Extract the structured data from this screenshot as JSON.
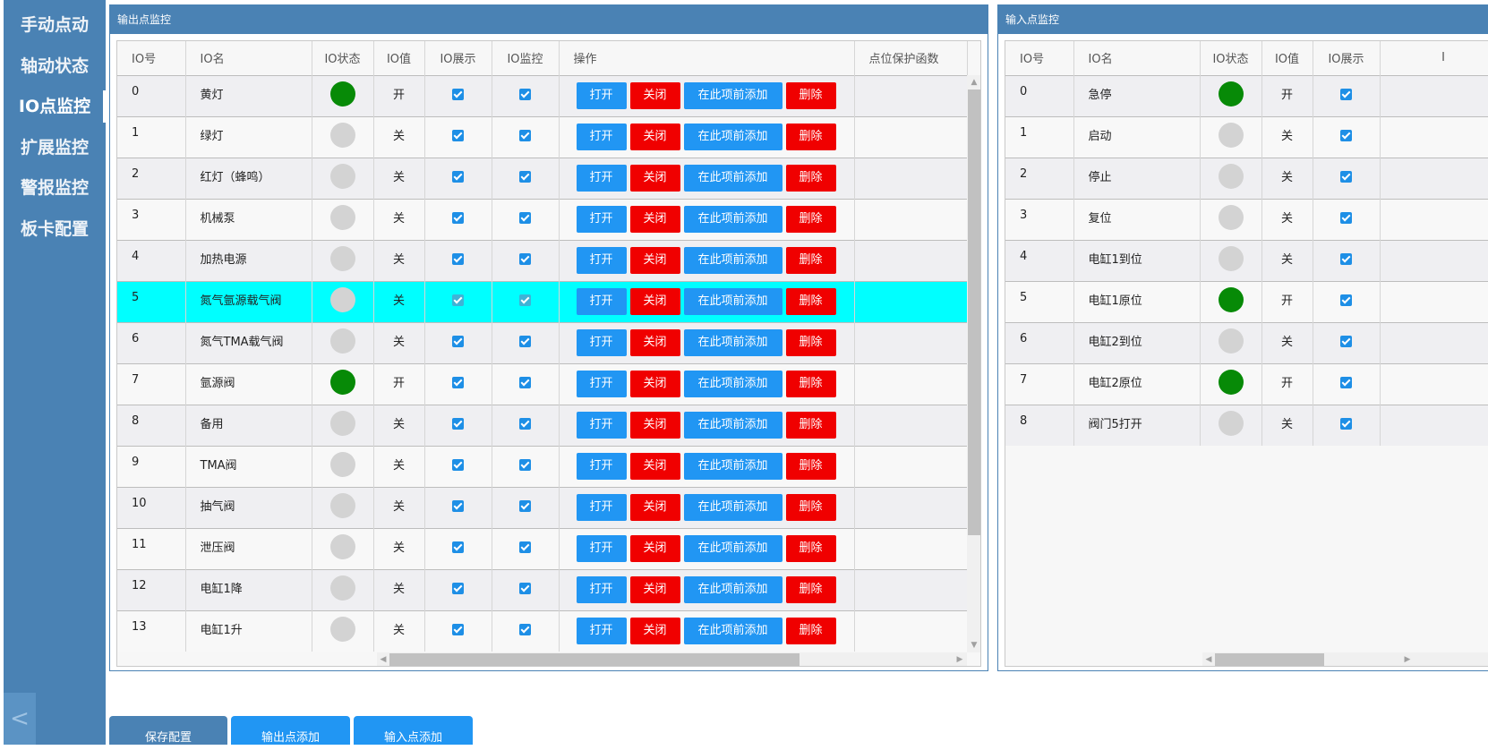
{
  "sidebar": {
    "items": [
      {
        "label": "手动点动"
      },
      {
        "label": "轴动状态"
      },
      {
        "label": "IO点监控",
        "active": true
      },
      {
        "label": "扩展监控"
      },
      {
        "label": "警报监控"
      },
      {
        "label": "板卡配置"
      }
    ],
    "collapse_label": "<"
  },
  "output_panel": {
    "title": "输出点监控",
    "columns": [
      "IO号",
      "IO名",
      "IO状态",
      "IO值",
      "IO展示",
      "IO监控",
      "操作",
      "点位保护函数"
    ],
    "action_labels": {
      "open": "打开",
      "close": "关闭",
      "add_before": "在此项前添加",
      "delete": "删除"
    },
    "rows": [
      {
        "no": "0",
        "name": "黄灯",
        "on": true,
        "value": "开",
        "show": true,
        "monitor": true
      },
      {
        "no": "1",
        "name": "绿灯",
        "on": false,
        "value": "关",
        "show": true,
        "monitor": true
      },
      {
        "no": "2",
        "name": "红灯（蜂鸣）",
        "on": false,
        "value": "关",
        "show": true,
        "monitor": true
      },
      {
        "no": "3",
        "name": "机械泵",
        "on": false,
        "value": "关",
        "show": true,
        "monitor": true
      },
      {
        "no": "4",
        "name": "加热电源",
        "on": false,
        "value": "关",
        "show": true,
        "monitor": true
      },
      {
        "no": "5",
        "name": "氮气氩源载气阀",
        "on": false,
        "value": "关",
        "show": true,
        "monitor": true,
        "selected": true
      },
      {
        "no": "6",
        "name": "氮气TMA载气阀",
        "on": false,
        "value": "关",
        "show": true,
        "monitor": true
      },
      {
        "no": "7",
        "name": "氩源阀",
        "on": true,
        "value": "开",
        "show": true,
        "monitor": true
      },
      {
        "no": "8",
        "name": "备用",
        "on": false,
        "value": "关",
        "show": true,
        "monitor": true
      },
      {
        "no": "9",
        "name": "TMA阀",
        "on": false,
        "value": "关",
        "show": true,
        "monitor": true
      },
      {
        "no": "10",
        "name": "抽气阀",
        "on": false,
        "value": "关",
        "show": true,
        "monitor": true
      },
      {
        "no": "11",
        "name": "泄压阀",
        "on": false,
        "value": "关",
        "show": true,
        "monitor": true
      },
      {
        "no": "12",
        "name": "电缸1降",
        "on": false,
        "value": "关",
        "show": true,
        "monitor": true
      },
      {
        "no": "13",
        "name": "电缸1升",
        "on": false,
        "value": "关",
        "show": true,
        "monitor": true
      }
    ]
  },
  "input_panel": {
    "title": "输入点监控",
    "columns": [
      "IO号",
      "IO名",
      "IO状态",
      "IO值",
      "IO展示",
      "I"
    ],
    "rows": [
      {
        "no": "0",
        "name": "急停",
        "on": true,
        "value": "开",
        "show": true
      },
      {
        "no": "1",
        "name": "启动",
        "on": false,
        "value": "关",
        "show": true
      },
      {
        "no": "2",
        "name": "停止",
        "on": false,
        "value": "关",
        "show": true
      },
      {
        "no": "3",
        "name": "复位",
        "on": false,
        "value": "关",
        "show": true
      },
      {
        "no": "4",
        "name": "电缸1到位",
        "on": false,
        "value": "关",
        "show": true
      },
      {
        "no": "5",
        "name": "电缸1原位",
        "on": true,
        "value": "开",
        "show": true
      },
      {
        "no": "6",
        "name": "电缸2到位",
        "on": false,
        "value": "关",
        "show": true
      },
      {
        "no": "7",
        "name": "电缸2原位",
        "on": true,
        "value": "开",
        "show": true
      },
      {
        "no": "8",
        "name": "阀门5打开",
        "on": false,
        "value": "关",
        "show": true
      }
    ]
  },
  "bottom_buttons": [
    {
      "label": "保存配置",
      "color": "#4a82b4"
    },
    {
      "label": "输出点添加",
      "color": "#2196f3"
    },
    {
      "label": "输入点添加",
      "color": "#2196f3"
    }
  ],
  "colors": {
    "accent": "#4a82b4",
    "button_blue": "#2196f3",
    "button_red": "#f00000",
    "lamp_on": "#078a07",
    "lamp_off": "#d3d3d3",
    "selected_row": "#00ffff"
  }
}
